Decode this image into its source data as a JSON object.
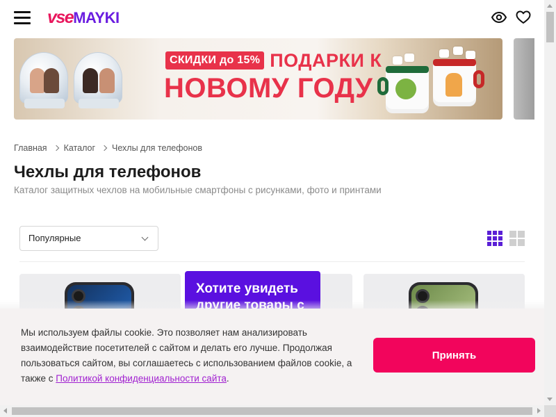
{
  "header": {
    "logo": {
      "part1": "vse",
      "part2": "MAYKI"
    }
  },
  "banner": {
    "badge": "СКИДКИ до 15%",
    "line1": "ПОДАРКИ К",
    "line2": "НОВОМУ ГОДУ"
  },
  "breadcrumb": [
    "Главная",
    "Каталог",
    "Чехлы для телефонов"
  ],
  "page": {
    "title": "Чехлы для телефонов",
    "subtitle": "Каталог защитных чехлов на мобильные смартфоны с рисунками, фото и принтами"
  },
  "sort": {
    "selected": "Популярные"
  },
  "promo_card": {
    "text": "Хотите увидеть другие товары с"
  },
  "cookie": {
    "text": "Мы используем файлы cookie. Это позволяет нам анализировать взаимодействие посетителей с сайтом и делать его лучше. Продолжая пользоваться сайтом, вы соглашаетесь с использованием файлов cookie, а также с ",
    "link": "Политикой конфиденциальности сайта",
    "end": ".",
    "accept_label": "Принять"
  },
  "colors": {
    "brand_pink": "#f2055c",
    "brand_purple": "#5a10e0",
    "logo_pink": "#e8175d",
    "logo_purple": "#6a1de0",
    "promo_red": "#e8324a"
  },
  "icons": {
    "menu": "menu-icon",
    "viewed": "eye-icon",
    "favorites": "heart-icon",
    "grid_small": "grid-3x3-icon",
    "grid_large": "grid-2x2-icon"
  }
}
